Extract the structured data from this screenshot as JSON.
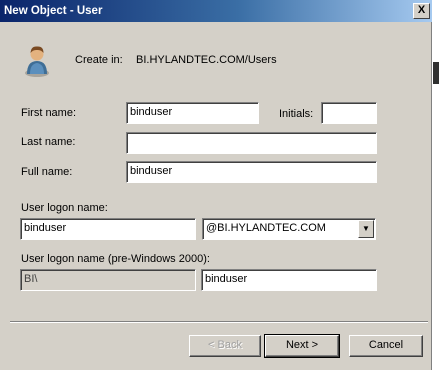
{
  "window": {
    "title": "New Object - User",
    "close_label": "X"
  },
  "header": {
    "create_in_label": "Create in:",
    "create_in_path": "BI.HYLANDTEC.COM/Users",
    "icon": "user-icon"
  },
  "form": {
    "first_name_label": "First name:",
    "first_name_value": "binduser",
    "initials_label": "Initials:",
    "initials_value": "",
    "last_name_label": "Last name:",
    "last_name_value": "",
    "full_name_label": "Full name:",
    "full_name_value": "binduser",
    "logon_label": "User logon name:",
    "logon_value": "binduser",
    "domain_value": "@BI.HYLANDTEC.COM",
    "pre2000_label": "User logon name (pre-Windows 2000):",
    "pre2000_domain_value": "BI\\",
    "pre2000_value": "binduser"
  },
  "buttons": {
    "back_label": "< Back",
    "next_label": "Next >",
    "cancel_label": "Cancel"
  }
}
